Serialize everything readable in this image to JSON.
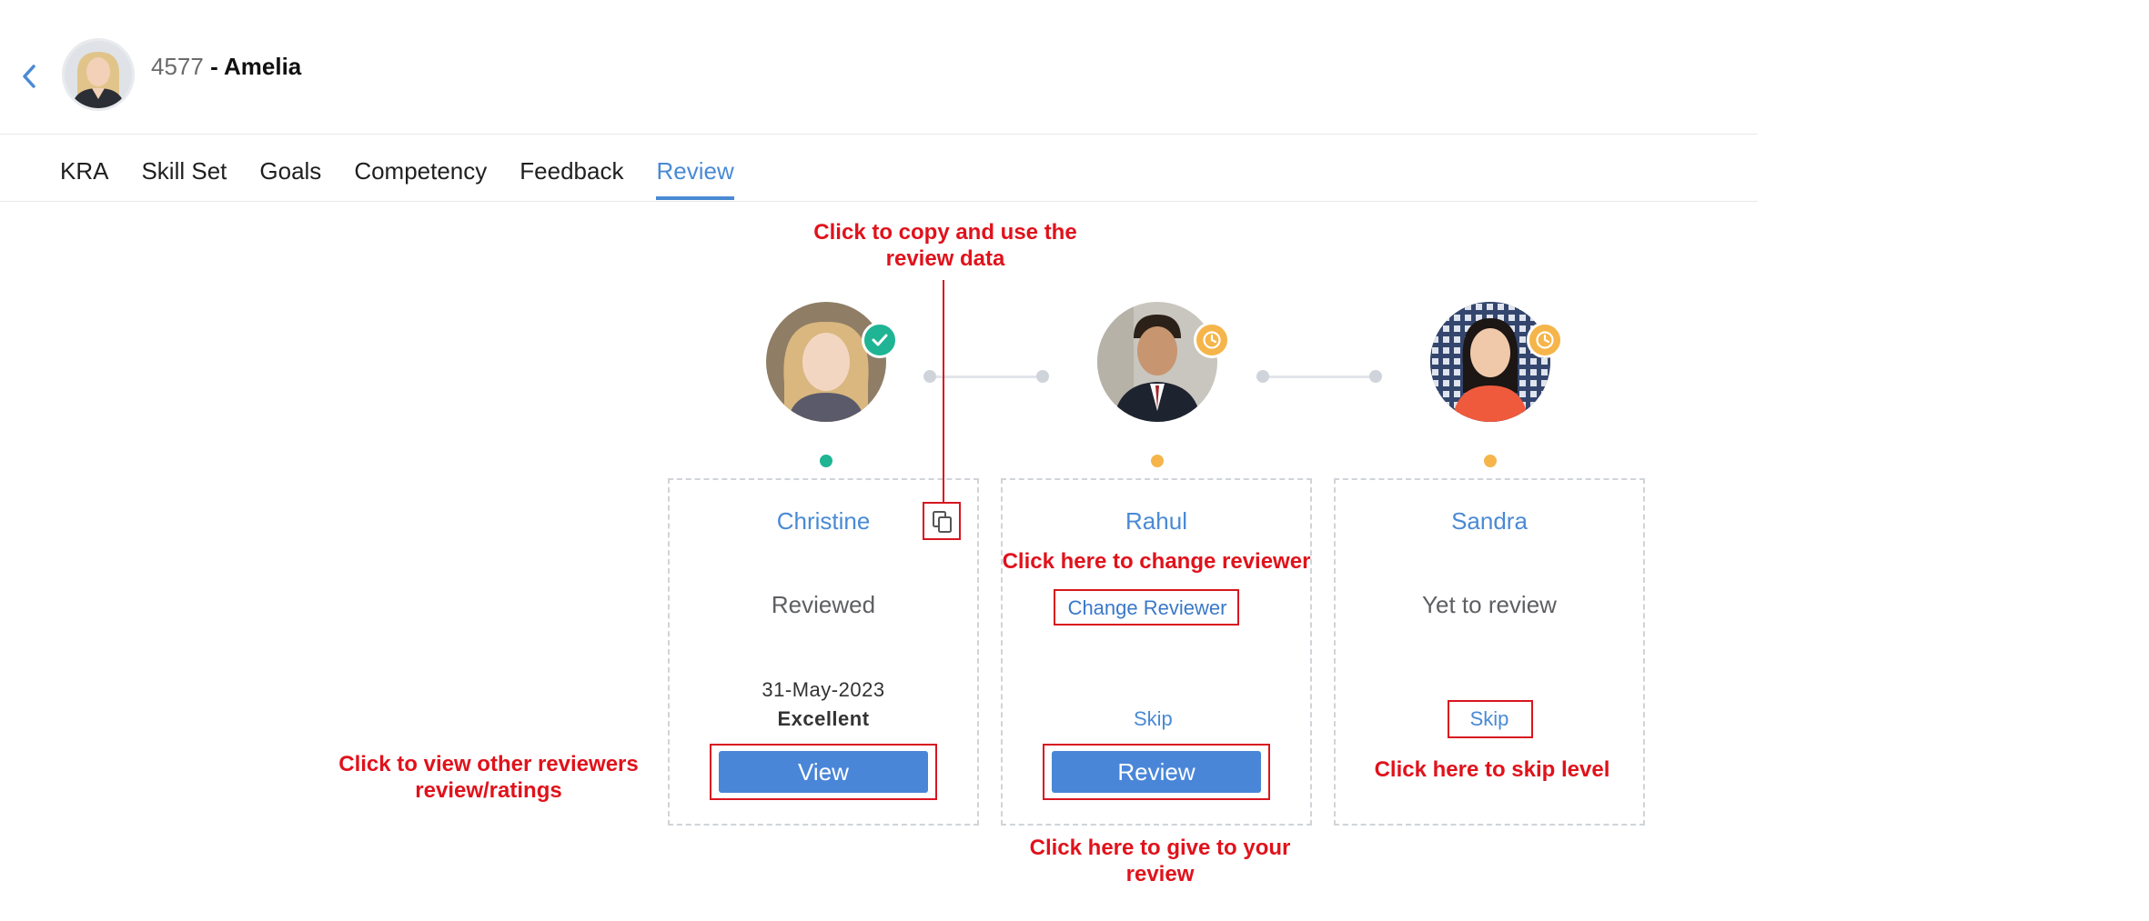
{
  "header": {
    "employee_id": "4577",
    "employee_name": " - Amelia"
  },
  "tabs": [
    {
      "label": "KRA"
    },
    {
      "label": "Skill Set"
    },
    {
      "label": "Goals"
    },
    {
      "label": "Competency"
    },
    {
      "label": "Feedback"
    },
    {
      "label": "Review",
      "active": true
    }
  ],
  "reviewers": [
    {
      "name": "Christine",
      "status": "Reviewed",
      "date": "31-May-2023",
      "rating": "Excellent",
      "button": "View",
      "badge": "check-icon"
    },
    {
      "name": "Rahul",
      "action_link": "Change Reviewer",
      "skip": "Skip",
      "button": "Review",
      "badge": "clock-icon"
    },
    {
      "name": "Sandra",
      "status": "Yet to review",
      "skip": "Skip",
      "badge": "clock-icon"
    }
  ],
  "annotations": {
    "copy": "Click to copy and use the\nreview data",
    "change": "Click here to change reviewer",
    "view": "Click to view other reviewers\nreview/ratings",
    "review": "Click here to give to your\nreview",
    "skip": "Click here to skip level"
  },
  "colors": {
    "accent": "#4a8ad4",
    "done": "#1fb494",
    "pending": "#f5b54a",
    "annotation": "#e0121b"
  }
}
